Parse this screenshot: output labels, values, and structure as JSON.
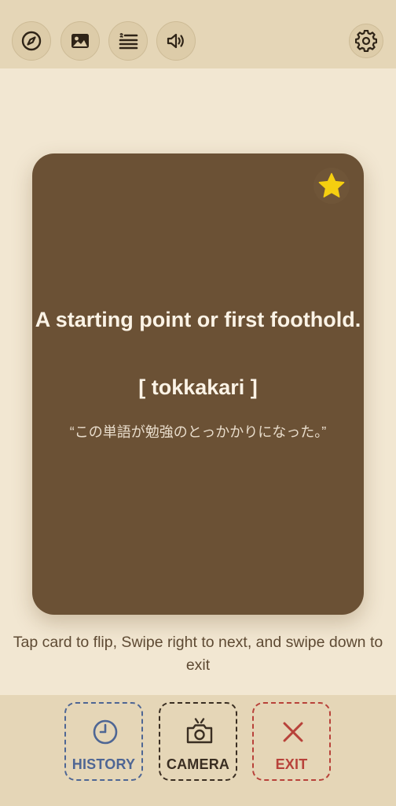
{
  "toolbar": {
    "icons": [
      "compass-icon",
      "image-icon",
      "subtitles-icon",
      "speaker-icon",
      "gear-icon"
    ]
  },
  "card": {
    "meaning": "A starting point or first foothold.",
    "reading": "[ tokkakari ]",
    "example": "“この単語が勉強のとっかかりになった。”",
    "starred": true
  },
  "hint": "Tap card to flip, Swipe right to next, and swipe down to exit",
  "actions": {
    "history": "HISTORY",
    "camera": "CAMERA",
    "exit": "EXIT"
  },
  "colors": {
    "background": "#f2e7d2",
    "bar": "#e5d6b7",
    "card": "#6b5135",
    "star": "#f5cf10",
    "history": "#4e6694",
    "camera": "#3a2e22",
    "exit": "#b8423a"
  }
}
